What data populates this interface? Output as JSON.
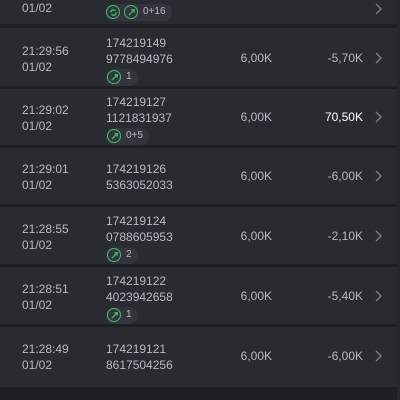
{
  "rows": [
    {
      "time": "",
      "date": "01/02",
      "id1": "",
      "id2": "",
      "badge": "0+16",
      "badge_icons": 2,
      "stake": "",
      "result": "",
      "win": false
    },
    {
      "time": "21:29:56",
      "date": "01/02",
      "id1": "174219149",
      "id2": "9778494976",
      "badge": "1",
      "badge_icons": 1,
      "stake": "6,00K",
      "result": "-5,70K",
      "win": false
    },
    {
      "time": "21:29:02",
      "date": "01/02",
      "id1": "174219127",
      "id2": "1121831937",
      "badge": "0+5",
      "badge_icons": 1,
      "stake": "6,00K",
      "result": "70,50K",
      "win": true
    },
    {
      "time": "21:29:01",
      "date": "01/02",
      "id1": "174219126",
      "id2": "5363052033",
      "badge": "",
      "badge_icons": 0,
      "stake": "6,00K",
      "result": "-6,00K",
      "win": false
    },
    {
      "time": "21:28:55",
      "date": "01/02",
      "id1": "174219124",
      "id2": "0788605953",
      "badge": "2",
      "badge_icons": 1,
      "stake": "6,00K",
      "result": "-2,10K",
      "win": false
    },
    {
      "time": "21:28:51",
      "date": "01/02",
      "id1": "174219122",
      "id2": "4023942658",
      "badge": "1",
      "badge_icons": 1,
      "stake": "6,00K",
      "result": "-5,40K",
      "win": false
    },
    {
      "time": "21:28:49",
      "date": "01/02",
      "id1": "174219121",
      "id2": "8617504256",
      "badge": "",
      "badge_icons": 0,
      "stake": "6,00K",
      "result": "-6,00K",
      "win": false
    }
  ],
  "colors": {
    "accent": "#3fbf6e",
    "row_bg": "#2a2b31",
    "gap_bg": "#1e1f24",
    "win_text": "#ffffff"
  },
  "icons": {
    "badge": "spin-arrows-icon",
    "refresh": "refresh-icon",
    "row_action": "chevron-right-icon"
  }
}
